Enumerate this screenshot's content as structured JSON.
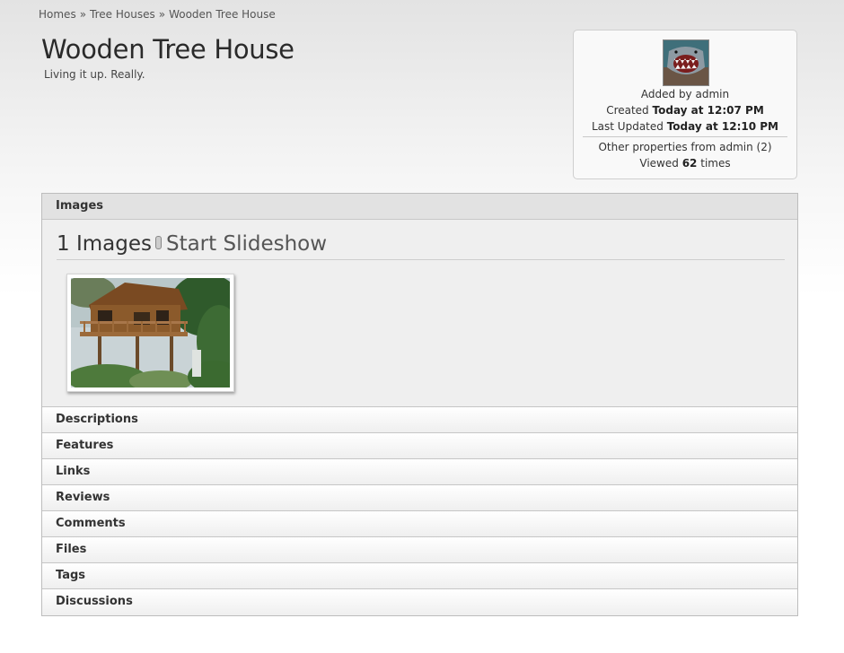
{
  "breadcrumb": {
    "items": [
      "Homes",
      "Tree Houses",
      "Wooden Tree House"
    ],
    "separator": "»"
  },
  "page": {
    "title": "Wooden Tree House",
    "subtitle": "Living it up. Really."
  },
  "info": {
    "added_prefix": "Added by",
    "added_user": "admin",
    "created_prefix": "Created",
    "created_value": "Today at 12:07 PM",
    "updated_prefix": "Last Updated",
    "updated_value": "Today at 12:10 PM",
    "other_properties": "Other properties from admin (2)",
    "viewed_prefix": "Viewed",
    "viewed_count": "62",
    "viewed_suffix": "times"
  },
  "images_section": {
    "label": "Images",
    "count_text": "1 Images",
    "slideshow_label": "Start Slideshow",
    "thumbnail_icon": "tree-house-photo"
  },
  "sections": [
    "Descriptions",
    "Features",
    "Links",
    "Reviews",
    "Comments",
    "Files",
    "Tags",
    "Discussions"
  ],
  "colors": {
    "panel_bg": "#efefef",
    "active_header": "#e2e2e2",
    "border": "#bdbdbd"
  }
}
